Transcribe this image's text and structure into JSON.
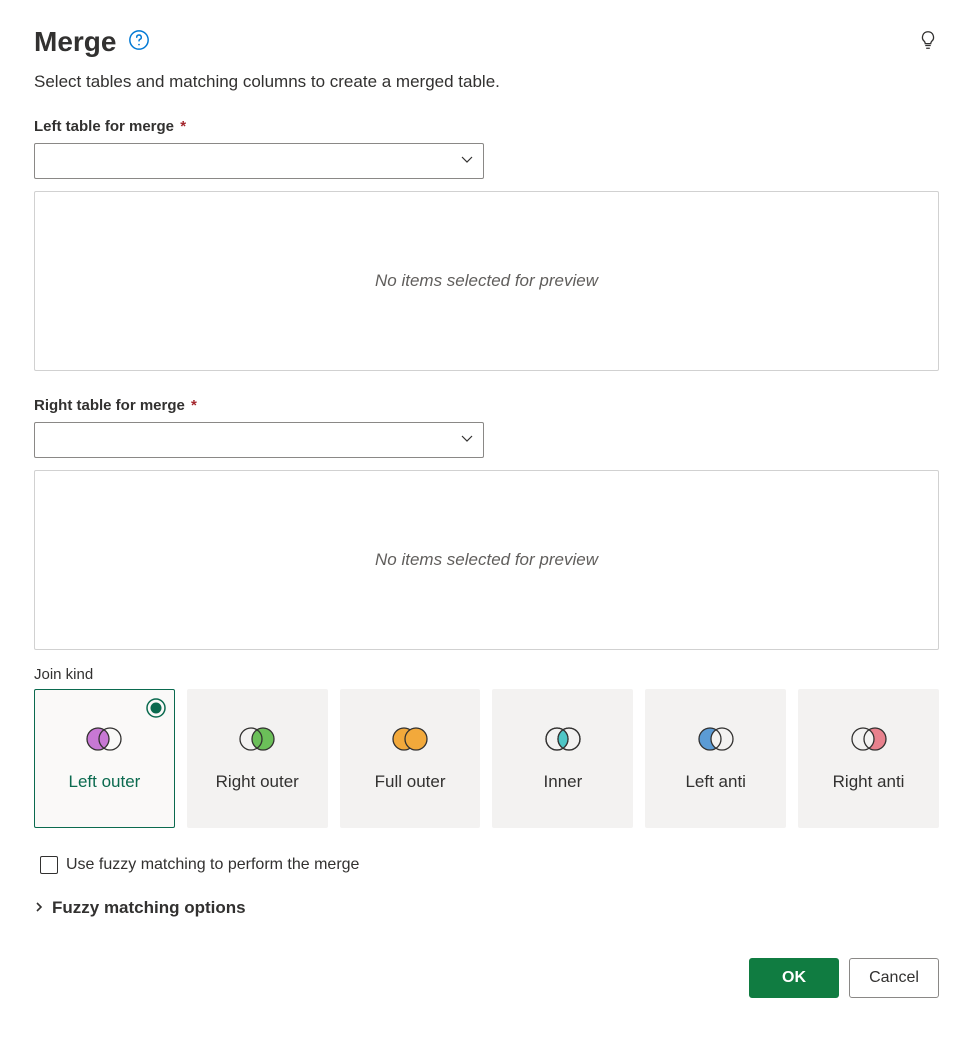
{
  "header": {
    "title": "Merge",
    "subtitle": "Select tables and matching columns to create a merged table."
  },
  "leftTable": {
    "label": "Left table for merge",
    "required": "*",
    "preview_empty": "No items selected for preview"
  },
  "rightTable": {
    "label": "Right table for merge",
    "required": "*",
    "preview_empty": "No items selected for preview"
  },
  "joinKind": {
    "label": "Join kind",
    "selected": "left-outer",
    "options": {
      "left_outer": "Left outer",
      "right_outer": "Right outer",
      "full_outer": "Full outer",
      "inner": "Inner",
      "left_anti": "Left anti",
      "right_anti": "Right anti"
    }
  },
  "fuzzy": {
    "checkbox_label": "Use fuzzy matching to perform the merge",
    "expander_label": "Fuzzy matching options"
  },
  "footer": {
    "ok": "OK",
    "cancel": "Cancel"
  },
  "icons": {
    "help": "help-icon",
    "bulb": "bulb-icon",
    "chevron_down": "chevron-down-icon",
    "chevron_right": "chevron-right-icon"
  }
}
